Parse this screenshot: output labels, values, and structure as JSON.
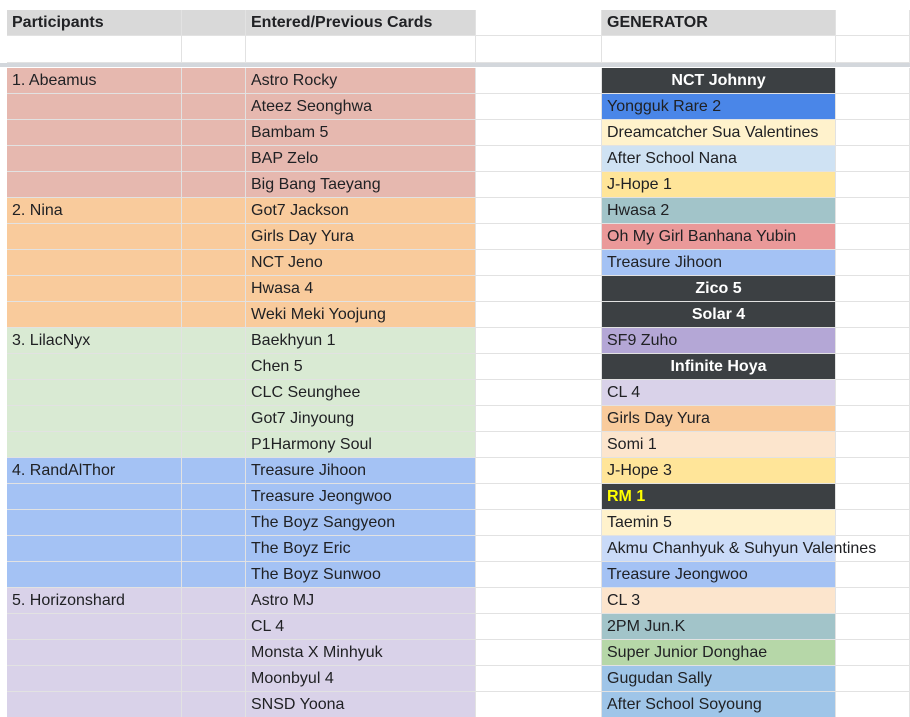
{
  "headers": {
    "participants": "Participants",
    "entered": "Entered/Previous Cards",
    "generator": "GENERATOR"
  },
  "colors": {
    "header_bg": "#d9d9d9",
    "gridline": "#e2e2e2",
    "freeze_bar": "#d3d7dc",
    "group_1": "#e6b8af",
    "group_2": "#f9cb9c",
    "group_3": "#d9ead3",
    "group_4": "#a4c2f4",
    "group_5": "#d9d2e9"
  },
  "participants": [
    {
      "name": "1. Abeamus",
      "color": "#e6b8af",
      "cards": [
        "Astro Rocky",
        "Ateez Seonghwa",
        "Bambam 5",
        "BAP Zelo",
        "Big Bang Taeyang"
      ]
    },
    {
      "name": "2. Nina",
      "color": "#f9cb9c",
      "cards": [
        "Got7 Jackson",
        "Girls Day Yura",
        "NCT Jeno",
        "Hwasa 4",
        "Weki Meki Yoojung"
      ]
    },
    {
      "name": "3. LilacNyx",
      "color": "#d9ead3",
      "cards": [
        "Baekhyun 1",
        "Chen 5",
        "CLC Seunghee",
        "Got7 Jinyoung",
        "P1Harmony Soul"
      ]
    },
    {
      "name": "4. RandAlThor",
      "color": "#a4c2f4",
      "cards": [
        "Treasure Jihoon",
        "Treasure Jeongwoo",
        "The Boyz Sangyeon",
        "The Boyz Eric",
        "The Boyz Sunwoo"
      ]
    },
    {
      "name": "5. Horizonshard",
      "color": "#d9d2e9",
      "cards": [
        "Astro MJ",
        "CL 4",
        "Monsta X Minhyuk",
        "Moonbyul 4",
        "SNSD Yoona"
      ]
    }
  ],
  "generator": [
    {
      "text": "NCT Johnny",
      "bg": "#3c4043",
      "fg": "#ffffff",
      "bold": true,
      "center": true
    },
    {
      "text": "Yongguk Rare 2",
      "bg": "#4a86e8",
      "fg": "#202124"
    },
    {
      "text": "Dreamcatcher Sua Valentines",
      "bg": "#fff2cc",
      "fg": "#202124"
    },
    {
      "text": "After School Nana",
      "bg": "#cfe2f3",
      "fg": "#202124"
    },
    {
      "text": "J-Hope 1",
      "bg": "#ffe599",
      "fg": "#202124"
    },
    {
      "text": "Hwasa 2",
      "bg": "#a2c4c9",
      "fg": "#202124"
    },
    {
      "text": "Oh My Girl Banhana Yubin",
      "bg": "#ea9999",
      "fg": "#202124"
    },
    {
      "text": "Treasure Jihoon",
      "bg": "#a4c2f4",
      "fg": "#202124"
    },
    {
      "text": "Zico 5",
      "bg": "#3c4043",
      "fg": "#ffffff",
      "bold": true,
      "center": true
    },
    {
      "text": "Solar 4",
      "bg": "#3c4043",
      "fg": "#ffffff",
      "bold": true,
      "center": true
    },
    {
      "text": "SF9 Zuho",
      "bg": "#b4a7d6",
      "fg": "#202124"
    },
    {
      "text": "Infinite Hoya",
      "bg": "#3c4043",
      "fg": "#ffffff",
      "bold": true,
      "center": true
    },
    {
      "text": "CL 4",
      "bg": "#d9d2e9",
      "fg": "#202124"
    },
    {
      "text": "Girls Day Yura",
      "bg": "#f9cb9c",
      "fg": "#202124"
    },
    {
      "text": "Somi 1",
      "bg": "#fce5cd",
      "fg": "#202124"
    },
    {
      "text": "J-Hope 3",
      "bg": "#ffe599",
      "fg": "#202124"
    },
    {
      "text": "RM 1",
      "bg": "#3c4043",
      "fg": "#ffff00",
      "bold": true
    },
    {
      "text": "Taemin 5",
      "bg": "#fff2cc",
      "fg": "#202124"
    },
    {
      "text": "Akmu Chanhyuk & Suhyun Valentines",
      "bg": "#c9daf8",
      "fg": "#202124"
    },
    {
      "text": "Treasure Jeongwoo",
      "bg": "#a4c2f4",
      "fg": "#202124"
    },
    {
      "text": "CL 3",
      "bg": "#fce5cd",
      "fg": "#202124"
    },
    {
      "text": "2PM Jun.K",
      "bg": "#a2c4c9",
      "fg": "#202124"
    },
    {
      "text": "Super Junior Donghae",
      "bg": "#b6d7a8",
      "fg": "#202124"
    },
    {
      "text": "Gugudan Sally",
      "bg": "#9fc5e8",
      "fg": "#202124"
    },
    {
      "text": "After School Soyoung",
      "bg": "#9fc5e8",
      "fg": "#202124"
    }
  ]
}
